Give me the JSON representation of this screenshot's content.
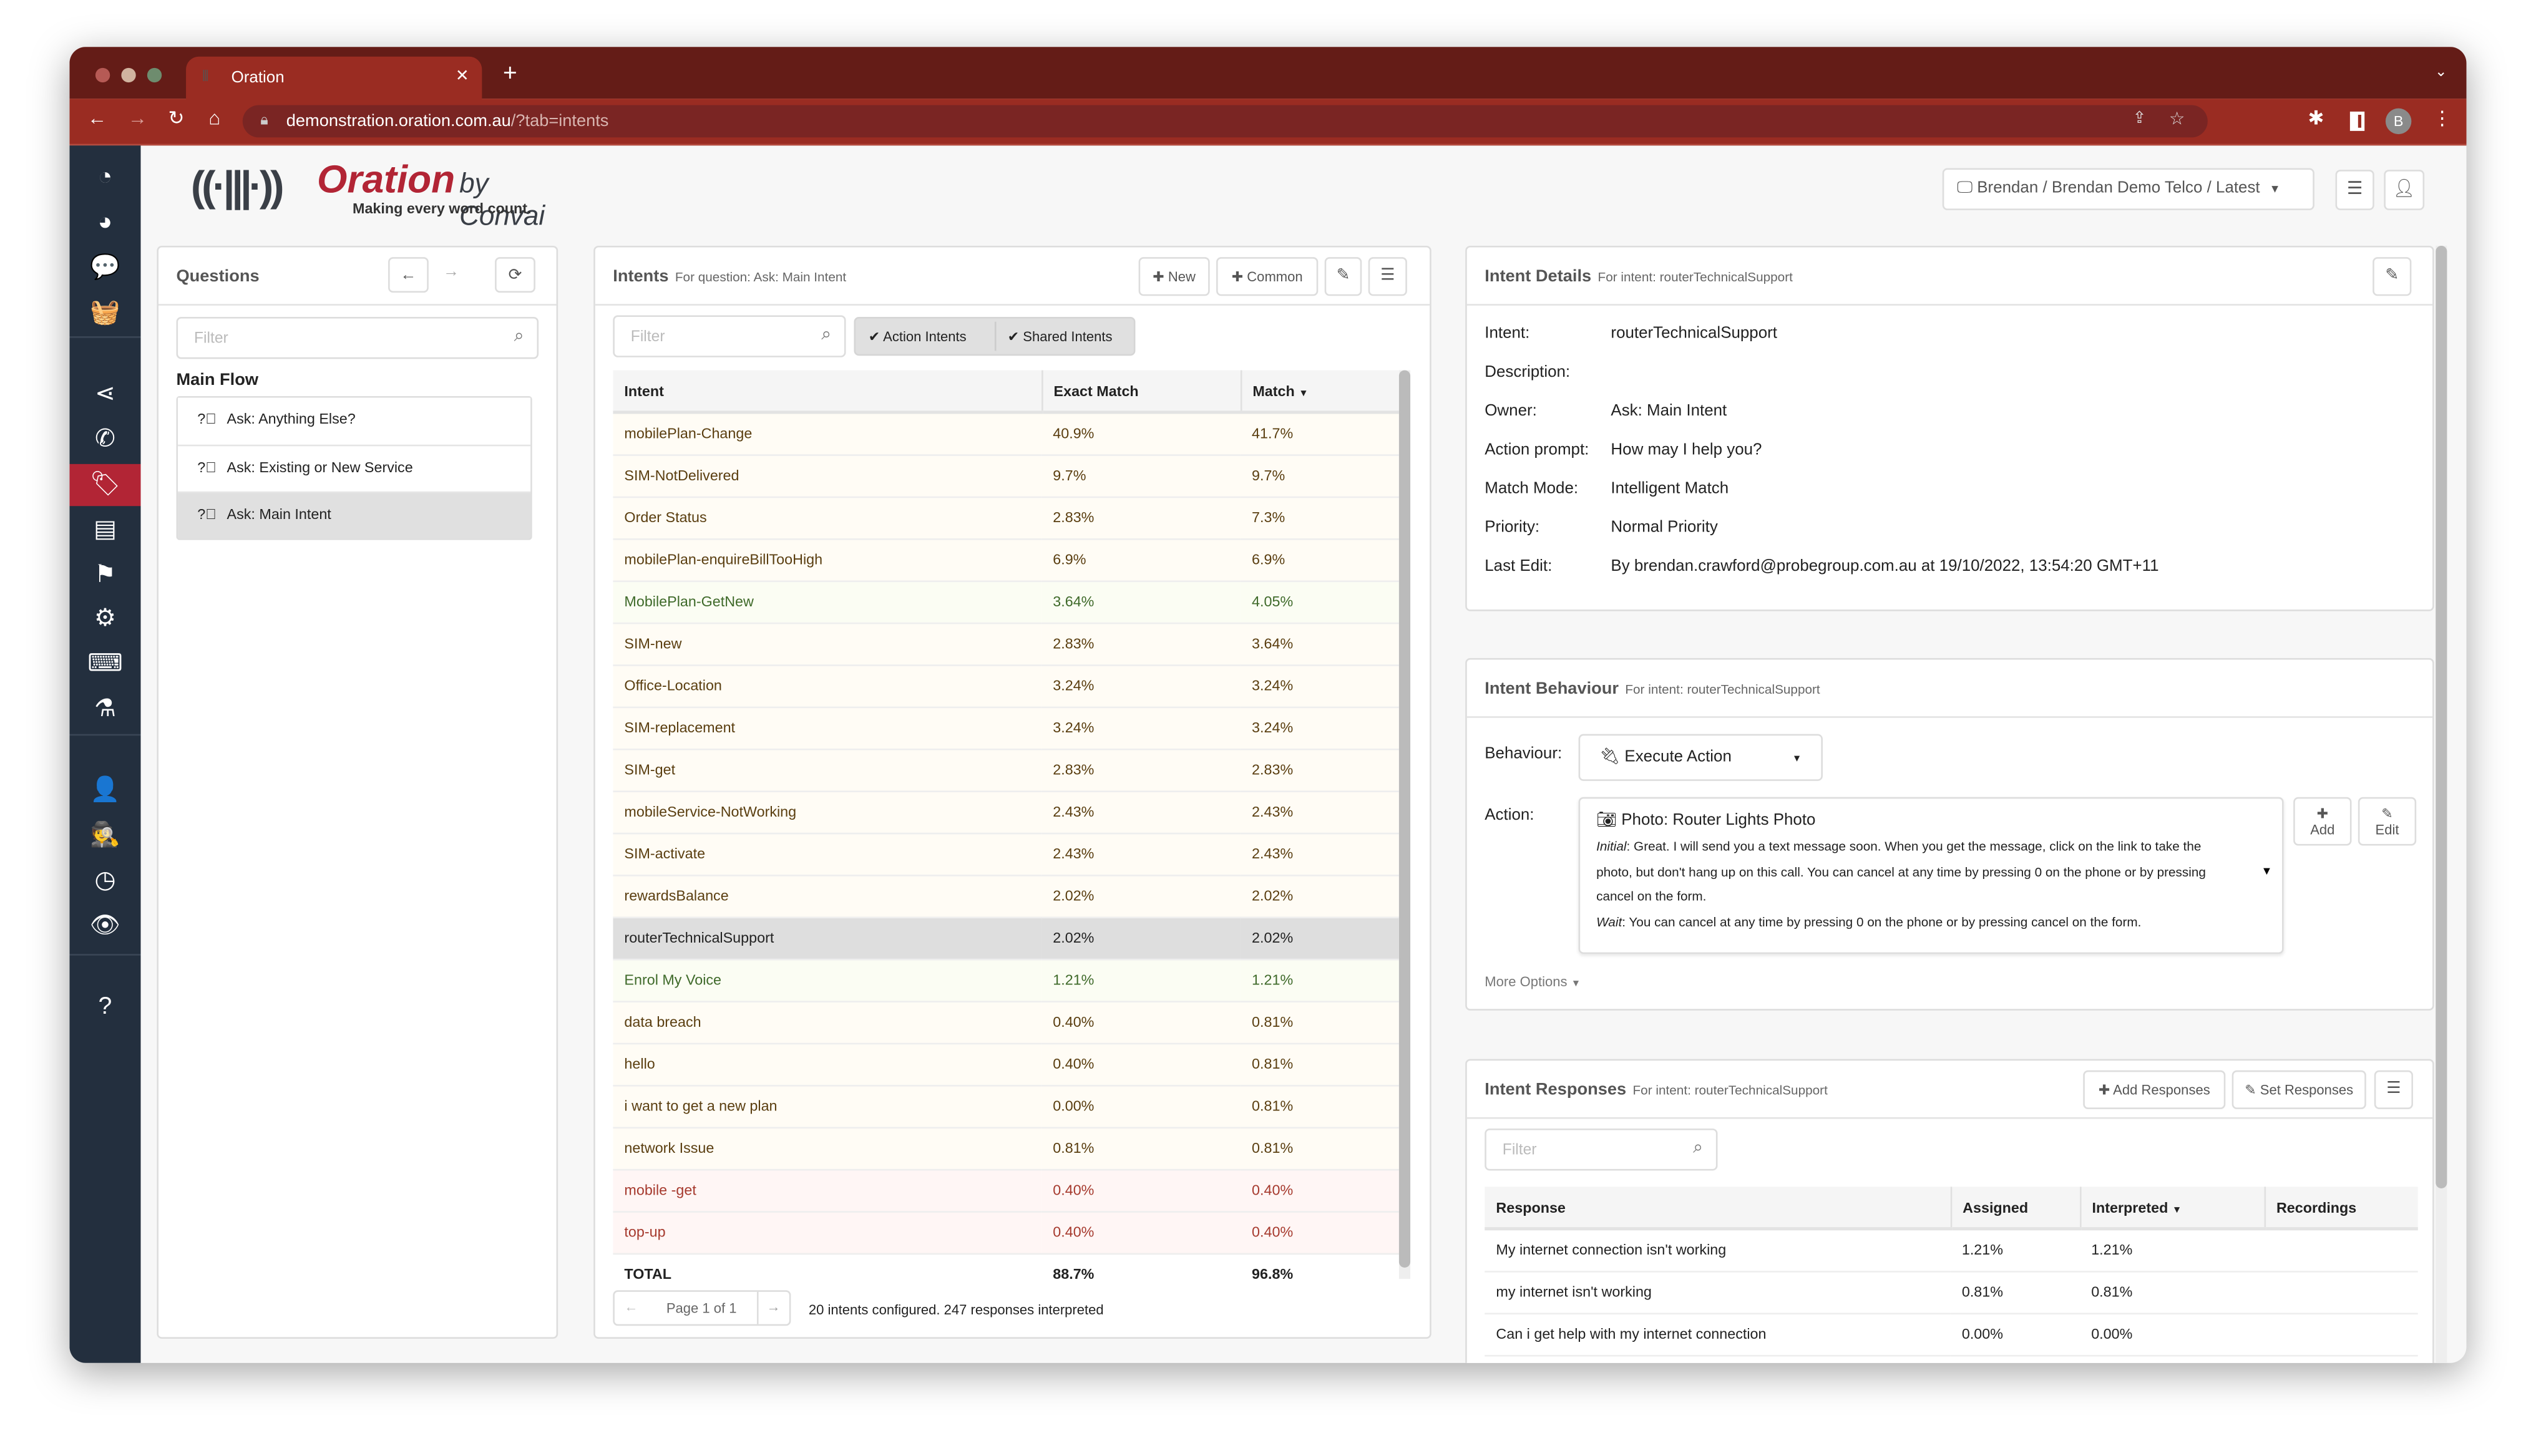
{
  "browser": {
    "tab_title": "Oration",
    "url_host": "demonstration.oration.com.au",
    "url_path": "/?tab=intents",
    "profile_initial": "B"
  },
  "colors": {
    "brand_red": "#b22535",
    "sidebar_bg": "#232f3e",
    "browser_red": "#9a2c22"
  },
  "logo": {
    "name": "Oration",
    "by": "by Convai",
    "tagline": "Making every word count."
  },
  "header": {
    "project_selector": "Brendan / Brendan Demo Telco / Latest"
  },
  "sidebar": {
    "items": [
      {
        "icon": "dashboard-icon",
        "glyph": "◔"
      },
      {
        "icon": "pie-chart-icon",
        "glyph": "◕"
      },
      {
        "icon": "comments-icon",
        "glyph": "💬"
      },
      {
        "icon": "basket-icon",
        "glyph": "🧺"
      },
      {
        "icon": "share-icon",
        "glyph": "⋖"
      },
      {
        "icon": "phone-icon",
        "glyph": "✆"
      },
      {
        "icon": "tags-icon",
        "glyph": "🏷",
        "active": true
      },
      {
        "icon": "book-icon",
        "glyph": "▤"
      },
      {
        "icon": "flag-icon",
        "glyph": "⚑"
      },
      {
        "icon": "gear-icon",
        "glyph": "⚙"
      },
      {
        "icon": "keyboard-icon",
        "glyph": "⌨"
      },
      {
        "icon": "flask-icon",
        "glyph": "⚗"
      },
      {
        "icon": "user-icon",
        "glyph": "👤"
      },
      {
        "icon": "user-secret-icon",
        "glyph": "🕵"
      },
      {
        "icon": "history-icon",
        "glyph": "◷"
      },
      {
        "icon": "eye-icon",
        "glyph": "👁"
      },
      {
        "icon": "help-icon",
        "glyph": "?"
      }
    ]
  },
  "questions": {
    "title": "Questions",
    "filter_placeholder": "Filter",
    "group": "Main Flow",
    "items": [
      "Ask: Anything Else?",
      "Ask: Existing or New Service",
      "Ask: Main Intent"
    ],
    "selected": 2
  },
  "intents": {
    "title": "Intents",
    "subtitle": "For question: Ask: Main Intent",
    "new_label": "New",
    "common_label": "Common",
    "filter_placeholder": "Filter",
    "toggle_action": "Action Intents",
    "toggle_shared": "Shared Intents",
    "columns": [
      "Intent",
      "Exact Match",
      "Match"
    ],
    "rows": [
      {
        "intent": "mobilePlan-Change",
        "exact": "40.9%",
        "match": "41.7%",
        "status": "neutral"
      },
      {
        "intent": "SIM-NotDelivered",
        "exact": "9.7%",
        "match": "9.7%",
        "status": "neutral"
      },
      {
        "intent": "Order Status",
        "exact": "2.83%",
        "match": "7.3%",
        "status": "neutral"
      },
      {
        "intent": "mobilePlan-enquireBillTooHigh",
        "exact": "6.9%",
        "match": "6.9%",
        "status": "neutral"
      },
      {
        "intent": "MobilePlan-GetNew",
        "exact": "3.64%",
        "match": "4.05%",
        "status": "good"
      },
      {
        "intent": "SIM-new",
        "exact": "2.83%",
        "match": "3.64%",
        "status": "neutral"
      },
      {
        "intent": "Office-Location",
        "exact": "3.24%",
        "match": "3.24%",
        "status": "neutral"
      },
      {
        "intent": "SIM-replacement",
        "exact": "3.24%",
        "match": "3.24%",
        "status": "neutral"
      },
      {
        "intent": "SIM-get",
        "exact": "2.83%",
        "match": "2.83%",
        "status": "neutral"
      },
      {
        "intent": "mobileService-NotWorking",
        "exact": "2.43%",
        "match": "2.43%",
        "status": "neutral"
      },
      {
        "intent": "SIM-activate",
        "exact": "2.43%",
        "match": "2.43%",
        "status": "neutral"
      },
      {
        "intent": "rewardsBalance",
        "exact": "2.02%",
        "match": "2.02%",
        "status": "neutral"
      },
      {
        "intent": "routerTechnicalSupport",
        "exact": "2.02%",
        "match": "2.02%",
        "status": "sel"
      },
      {
        "intent": "Enrol My Voice",
        "exact": "1.21%",
        "match": "1.21%",
        "status": "good"
      },
      {
        "intent": "data breach",
        "exact": "0.40%",
        "match": "0.81%",
        "status": "neutral"
      },
      {
        "intent": "hello",
        "exact": "0.40%",
        "match": "0.81%",
        "status": "neutral"
      },
      {
        "intent": "i want to get a new plan",
        "exact": "0.00%",
        "match": "0.81%",
        "status": "neutral"
      },
      {
        "intent": "network Issue",
        "exact": "0.81%",
        "match": "0.81%",
        "status": "neutral"
      },
      {
        "intent": "mobile -get",
        "exact": "0.40%",
        "match": "0.40%",
        "status": "bad"
      },
      {
        "intent": "top-up",
        "exact": "0.40%",
        "match": "0.40%",
        "status": "bad"
      }
    ],
    "total": {
      "label": "TOTAL",
      "exact": "88.7%",
      "match": "96.8%"
    },
    "page": "Page 1 of 1",
    "summary": "20 intents configured. 247 responses interpreted"
  },
  "details": {
    "title": "Intent Details",
    "subtitle": "For intent: routerTechnicalSupport",
    "fields": [
      {
        "label": "Intent:",
        "value": "routerTechnicalSupport"
      },
      {
        "label": "Description:",
        "value": ""
      },
      {
        "label": "Owner:",
        "value": "Ask: Main Intent"
      },
      {
        "label": "Action prompt:",
        "value": "How may I help you?"
      },
      {
        "label": "Match Mode:",
        "value": "Intelligent Match"
      },
      {
        "label": "Priority:",
        "value": "Normal Priority"
      },
      {
        "label": "Last Edit:",
        "value": "By brendan.crawford@probegroup.com.au at 19/10/2022, 13:54:20 GMT+11"
      }
    ]
  },
  "behaviour": {
    "title": "Intent Behaviour",
    "subtitle": "For intent: routerTechnicalSupport",
    "behaviour_label": "Behaviour:",
    "behaviour_value": "Execute Action",
    "action_label": "Action:",
    "action_title": "Photo: Router Lights Photo",
    "initial_label": "Initial",
    "initial_text": ": Great. I will send you a text message soon. When you get the message, click on the link to take the photo, but don't hang up on this call. You can cancel at any time by pressing 0 on the phone or by pressing cancel on the form.",
    "wait_label": "Wait",
    "wait_text": ": You can cancel at any time by pressing 0 on the phone or by pressing cancel on the form.",
    "add_label": "Add",
    "edit_label": "Edit",
    "more_options": "More Options"
  },
  "responses": {
    "title": "Intent Responses",
    "subtitle": "For intent: routerTechnicalSupport",
    "add_label": "Add Responses",
    "set_label": "Set Responses",
    "filter_placeholder": "Filter",
    "columns": [
      "Response",
      "Assigned",
      "Interpreted",
      "Recordings"
    ],
    "rows": [
      {
        "response": "My internet connection isn't working",
        "assigned": "1.21%",
        "interpreted": "1.21%",
        "recordings": ""
      },
      {
        "response": "my internet isn't working",
        "assigned": "0.81%",
        "interpreted": "0.81%",
        "recordings": ""
      },
      {
        "response": "Can i get help with my internet connection",
        "assigned": "0.00%",
        "interpreted": "0.00%",
        "recordings": ""
      }
    ]
  }
}
